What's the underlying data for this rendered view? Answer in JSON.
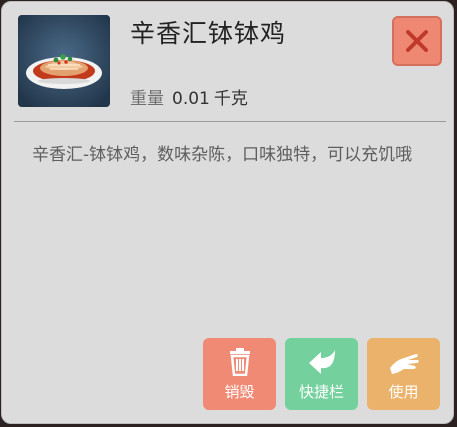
{
  "item": {
    "name": "辛香汇钵钵鸡",
    "image_icon": "dish-image",
    "weight_label": "重量",
    "weight_value": "0.01",
    "weight_unit": "千克",
    "description": "辛香汇-钵钵鸡，数味杂陈，口味独特，可以充饥哦"
  },
  "actions": {
    "close_icon": "close-icon",
    "destroy_label": "销毁",
    "destroy_icon": "trash-icon",
    "quickbar_label": "快捷栏",
    "quickbar_icon": "arrow-left-icon",
    "use_label": "使用",
    "use_icon": "hand-icon"
  },
  "colors": {
    "panel_bg": "#dcdcdc",
    "close": "#ef8873",
    "destroy": "#f08a74",
    "quickbar": "#74d19e",
    "use": "#eab26a"
  }
}
